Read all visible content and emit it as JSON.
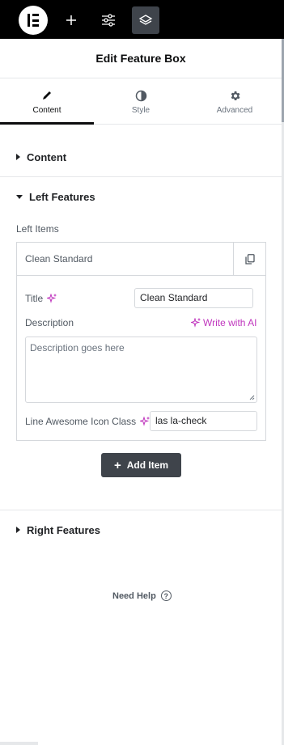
{
  "topbar": {
    "logo_icon": "elementor-logo-icon",
    "buttons": [
      {
        "icon": "plus-icon"
      },
      {
        "icon": "sliders-icon"
      },
      {
        "icon": "layers-icon",
        "active": true
      }
    ]
  },
  "header": {
    "title": "Edit Feature Box"
  },
  "tabs": [
    {
      "label": "Content",
      "icon": "pencil-icon",
      "active": true
    },
    {
      "label": "Style",
      "icon": "half-circle-icon",
      "active": false
    },
    {
      "label": "Advanced",
      "icon": "gear-icon",
      "active": false
    }
  ],
  "sections": {
    "content": {
      "label": "Content",
      "expanded": false
    },
    "left_features": {
      "label": "Left Features",
      "expanded": true
    },
    "right_features": {
      "label": "Right Features",
      "expanded": false
    }
  },
  "left_features": {
    "items_label": "Left Items",
    "item": {
      "title": "Clean Standard",
      "duplicate_icon": "copy-icon",
      "fields": {
        "title_label": "Title",
        "title_value": "Clean Standard",
        "description_label": "Description",
        "write_ai_label": "Write with AI",
        "description_placeholder": "Description goes here",
        "icon_class_label": "Line Awesome Icon Class",
        "icon_class_value": "las la-check"
      }
    },
    "add_item_label": "Add Item"
  },
  "footer": {
    "help_label": "Need Help",
    "help_icon": "question-circle-icon"
  },
  "colors": {
    "accent": "#0c0d0e",
    "ai": "#c036be",
    "topbar": "#000000",
    "button": "#3f444b"
  }
}
